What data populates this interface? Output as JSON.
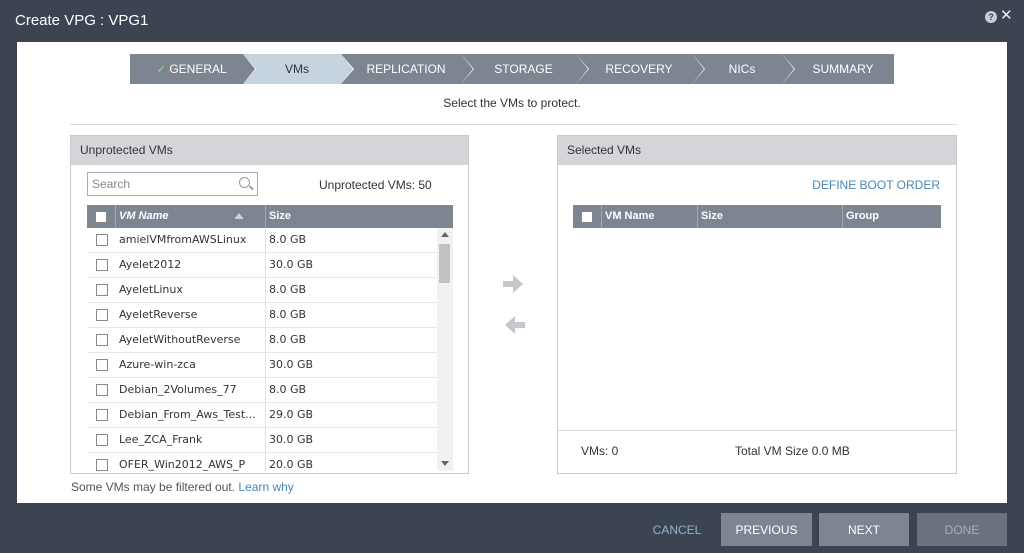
{
  "window": {
    "title": "Create VPG : VPG1"
  },
  "stepper": {
    "steps": [
      {
        "label": "GENERAL",
        "state": "done"
      },
      {
        "label": "VMs",
        "state": "active"
      },
      {
        "label": "REPLICATION",
        "state": "pending"
      },
      {
        "label": "STORAGE",
        "state": "pending"
      },
      {
        "label": "RECOVERY",
        "state": "pending"
      },
      {
        "label": "NICs",
        "state": "pending"
      },
      {
        "label": "SUMMARY",
        "state": "pending"
      }
    ]
  },
  "subtitle": "Select the VMs to protect.",
  "unprotected": {
    "title": "Unprotected VMs",
    "search_placeholder": "Search",
    "count_label": "Unprotected VMs: 50",
    "columns": {
      "name": "VM Name",
      "size": "Size"
    },
    "rows": [
      {
        "name": "amielVMfromAWSLinux",
        "size": "8.0 GB"
      },
      {
        "name": "Ayelet2012",
        "size": "30.0 GB"
      },
      {
        "name": "AyeletLinux",
        "size": "8.0 GB"
      },
      {
        "name": "AyeletReverse",
        "size": "8.0 GB"
      },
      {
        "name": "AyeletWithoutReverse",
        "size": "8.0 GB"
      },
      {
        "name": "Azure-win-zca",
        "size": "30.0 GB"
      },
      {
        "name": "Debian_2Volumes_77",
        "size": "8.0 GB"
      },
      {
        "name": "Debian_From_Aws_Test...",
        "size": "29.0 GB"
      },
      {
        "name": "Lee_ZCA_Frank",
        "size": "30.0 GB"
      },
      {
        "name": "OFER_Win2012_AWS_P",
        "size": "20.0 GB"
      }
    ]
  },
  "selected": {
    "title": "Selected VMs",
    "define_boot_order": "DEFINE BOOT ORDER",
    "columns": {
      "name": "VM Name",
      "size": "Size",
      "group": "Group"
    },
    "vms_count": "VMs: 0",
    "total_size": "Total VM Size 0.0 MB"
  },
  "filter_note": {
    "text": "Some VMs may be filtered out.",
    "link": "Learn why"
  },
  "buttons": {
    "cancel": "CANCEL",
    "previous": "PREVIOUS",
    "next": "NEXT",
    "done": "DONE"
  },
  "colors": {
    "accent": "#4a87b8",
    "header": "#7d8591",
    "active_step": "#c6d4e0",
    "frame": "#3c4452"
  }
}
